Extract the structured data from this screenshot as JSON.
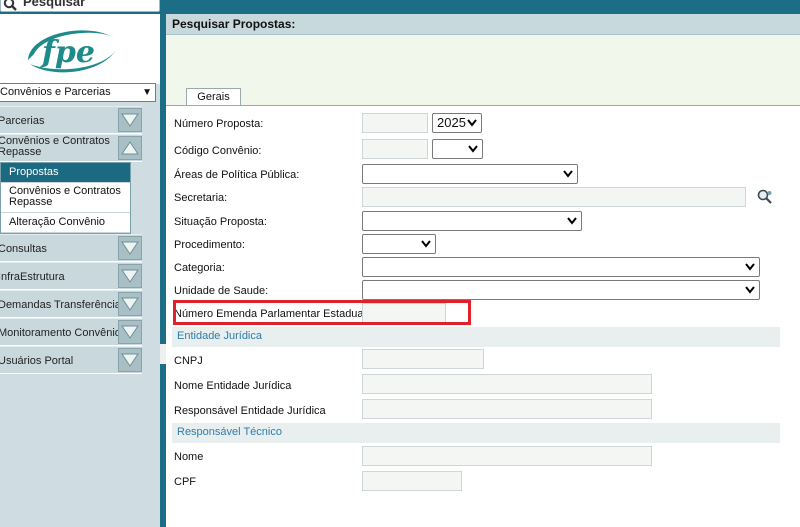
{
  "search": {
    "label": "Pesquisar"
  },
  "sidebar": {
    "logo_text": "fpe",
    "module_select": "Convênios e Parcerias",
    "menu": [
      {
        "label": "Parcerias"
      },
      {
        "label": "Convênios e Contratos Repasse",
        "line1": "Convênios e Contratos",
        "line2": "Repasse"
      },
      {
        "label": "Consultas"
      },
      {
        "label": "InfraEstrutura"
      },
      {
        "label": "Demandas Transferências"
      },
      {
        "label": "Monitoramento Convênios"
      },
      {
        "label": "Usuários Portal"
      }
    ],
    "submenu": [
      {
        "label": "Propostas"
      },
      {
        "label": "Convênios e Contratos Repasse",
        "line1": "Convênios e Contratos",
        "line2": "Repasse"
      },
      {
        "label": "Alteração Convênio"
      }
    ]
  },
  "main": {
    "title": "Pesquisar Propostas:",
    "tab": "Gerais",
    "fields": {
      "numero_proposta": "Número Proposta:",
      "numero_proposta_ano": "2025",
      "codigo_convenio": "Código Convênio:",
      "areas_politica": "Áreas de Política Pública:",
      "secretaria": "Secretaria:",
      "situacao_proposta": "Situação Proposta:",
      "procedimento": "Procedimento:",
      "categoria": "Categoria:",
      "unidade_saude": "Unidade de Saude:",
      "numero_emenda": "Número Emenda Parlamentar Estadual:"
    },
    "section_entidade": "Entidade Jurídica",
    "entidade": {
      "cnpj": "CNPJ",
      "nome": "Nome Entidade Jurídica",
      "responsavel": "Responsável Entidade Jurídica"
    },
    "section_tecnico": "Responsável Técnico",
    "tecnico": {
      "nome": "Nome",
      "cpf": "CPF"
    }
  },
  "colors": {
    "accent": "#1b6e86",
    "highlight": "#e0212b",
    "section_text": "#2c7eab"
  }
}
